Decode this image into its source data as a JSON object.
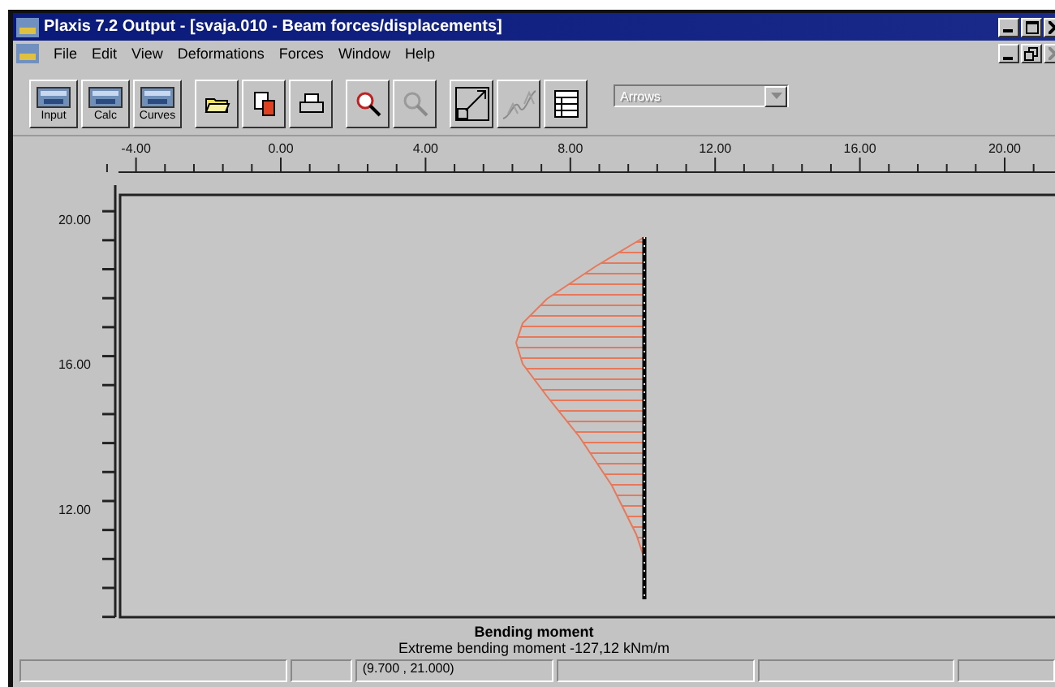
{
  "window": {
    "title": "Plaxis 7.2 Output - [svaja.010 - Beam forces/displacements]"
  },
  "menu": [
    "File",
    "Edit",
    "View",
    "Deformations",
    "Forces",
    "Window",
    "Help"
  ],
  "toolbar": [
    {
      "kind": "input",
      "label": "Input",
      "disabled": false
    },
    {
      "kind": "calc",
      "label": "Calc",
      "disabled": false
    },
    {
      "kind": "curves",
      "label": "Curves",
      "disabled": false
    },
    {
      "kind": "open",
      "disabled": false
    },
    {
      "kind": "copy",
      "disabled": false
    },
    {
      "kind": "print",
      "disabled": false
    },
    {
      "kind": "zoom-in",
      "disabled": false
    },
    {
      "kind": "zoom-out",
      "disabled": true
    },
    {
      "kind": "fit",
      "disabled": false
    },
    {
      "kind": "curve",
      "disabled": true
    },
    {
      "kind": "table",
      "disabled": false
    }
  ],
  "dropdown": {
    "value": "Arrows",
    "disabled": true
  },
  "plot": {
    "x_labels": [
      "-4.00",
      "0.00",
      "4.00",
      "8.00",
      "12.00",
      "16.00",
      "20.00"
    ],
    "y_labels": [
      "20.00",
      "16.00",
      "12.00"
    ],
    "title": "Bending moment",
    "subtitle": "Extreme bending moment -127,12 kNm/m"
  },
  "status_bar": {
    "coordinates": "(9.700 , 21.000)"
  }
}
